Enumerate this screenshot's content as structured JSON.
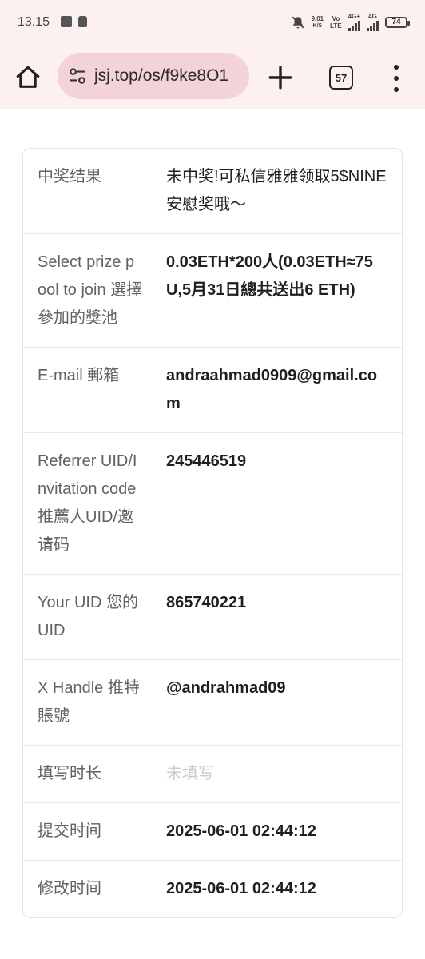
{
  "status_bar": {
    "time": "13.15",
    "net_speed_value": "9,01",
    "net_speed_unit": "K/S",
    "vo": "Vo",
    "lte": "LTE",
    "sig1": "4G+",
    "sig2": "4G",
    "battery": "74"
  },
  "browser": {
    "url": "jsj.top/os/f9ke8O1",
    "tab_count": "57"
  },
  "rows": [
    {
      "label": "中奖结果",
      "value": "未中奖!可私信雅雅领取5$NINE安慰奖哦～"
    },
    {
      "label": "Select prize pool to join 選擇參加的獎池",
      "value": "0.03ETH*200人(0.03ETH≈75U,5月31日總共送出6 ETH)"
    },
    {
      "label": "E-mail 郵箱",
      "value": "andraahmad0909@gmail.com"
    },
    {
      "label": "Referrer UID/Invitation code 推薦人UID/邀请码",
      "value": "245446519"
    },
    {
      "label": "Your UID 您的UID",
      "value": "865740221"
    },
    {
      "label": "X Handle 推特賬號",
      "value": "@andrahmad09"
    },
    {
      "label": "填写时长",
      "value": "未填写"
    },
    {
      "label": "提交时间",
      "value": "2025-06-01 02:44:12"
    },
    {
      "label": "修改时间",
      "value": "2025-06-01 02:44:12"
    }
  ]
}
